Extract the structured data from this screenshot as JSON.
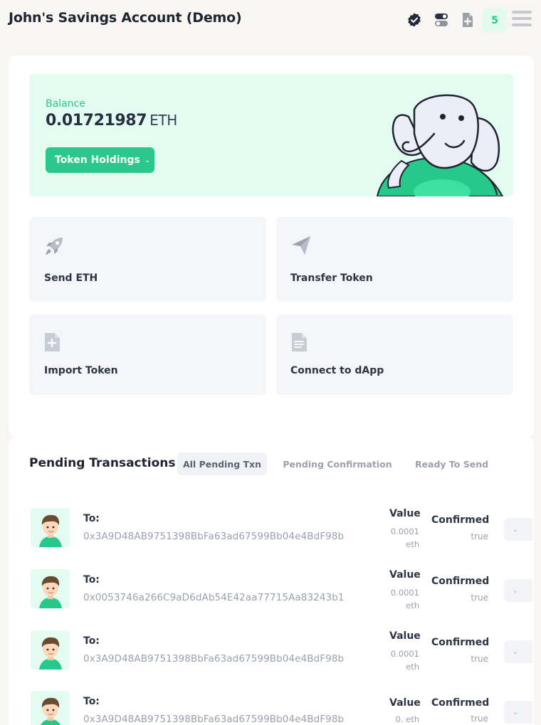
{
  "header": {
    "title": "John's Savings Account (Demo)",
    "icons": [
      "verified-badge-icon",
      "toggle-icon",
      "add-document-icon"
    ],
    "notification_count": "5",
    "menu_icon": "hamburger-menu-icon"
  },
  "balance": {
    "label": "Balance",
    "value": "0.01721987",
    "unit": "ETH",
    "button_label": "Token Holdings",
    "button_icon": "chevron-down-icon"
  },
  "actions": [
    {
      "label": "Send ETH",
      "icon": "rocket-icon"
    },
    {
      "label": "Transfer Token",
      "icon": "paper-plane-icon"
    },
    {
      "label": "Import Token",
      "icon": "add-file-icon"
    },
    {
      "label": "Connect to dApp",
      "icon": "document-icon"
    }
  ],
  "pending": {
    "title": "Pending Transactions",
    "tabs": [
      "All Pending Txn",
      "Pending Confirmation",
      "Ready To Send"
    ],
    "active_tab": "All Pending Txn",
    "rows": [
      {
        "to_label": "To:",
        "address": "0x3A9D48AB9751398BbFa63ad67599Bb04e4BdF98b",
        "value_label": "Value",
        "value_amount": "0.0001",
        "value_unit": "eth",
        "confirmed_label": "Confirmed",
        "confirmed": "true"
      },
      {
        "to_label": "To:",
        "address": "0x0053746a266C9aD6dAb54E42aa77715Aa83243b1",
        "value_label": "Value",
        "value_amount": "0.0001",
        "value_unit": "eth",
        "confirmed_label": "Confirmed",
        "confirmed": "true"
      },
      {
        "to_label": "To:",
        "address": "0x3A9D48AB9751398BbFa63ad67599Bb04e4BdF98b",
        "value_label": "Value",
        "value_amount": "0.0001",
        "value_unit": "eth",
        "confirmed_label": "Confirmed",
        "confirmed": "true"
      },
      {
        "to_label": "To:",
        "address": "0x3A9D48AB9751398BbFa63ad67599Bb04e4BdF98b",
        "value_label": "Value",
        "value_amount": "0.",
        "value_unit": "eth",
        "confirmed_label": "Confirmed",
        "confirmed": "true"
      }
    ]
  },
  "colors": {
    "accent": "#2cc78d",
    "accent_light": "#e3fcf2",
    "background": "#f7f6f3"
  }
}
